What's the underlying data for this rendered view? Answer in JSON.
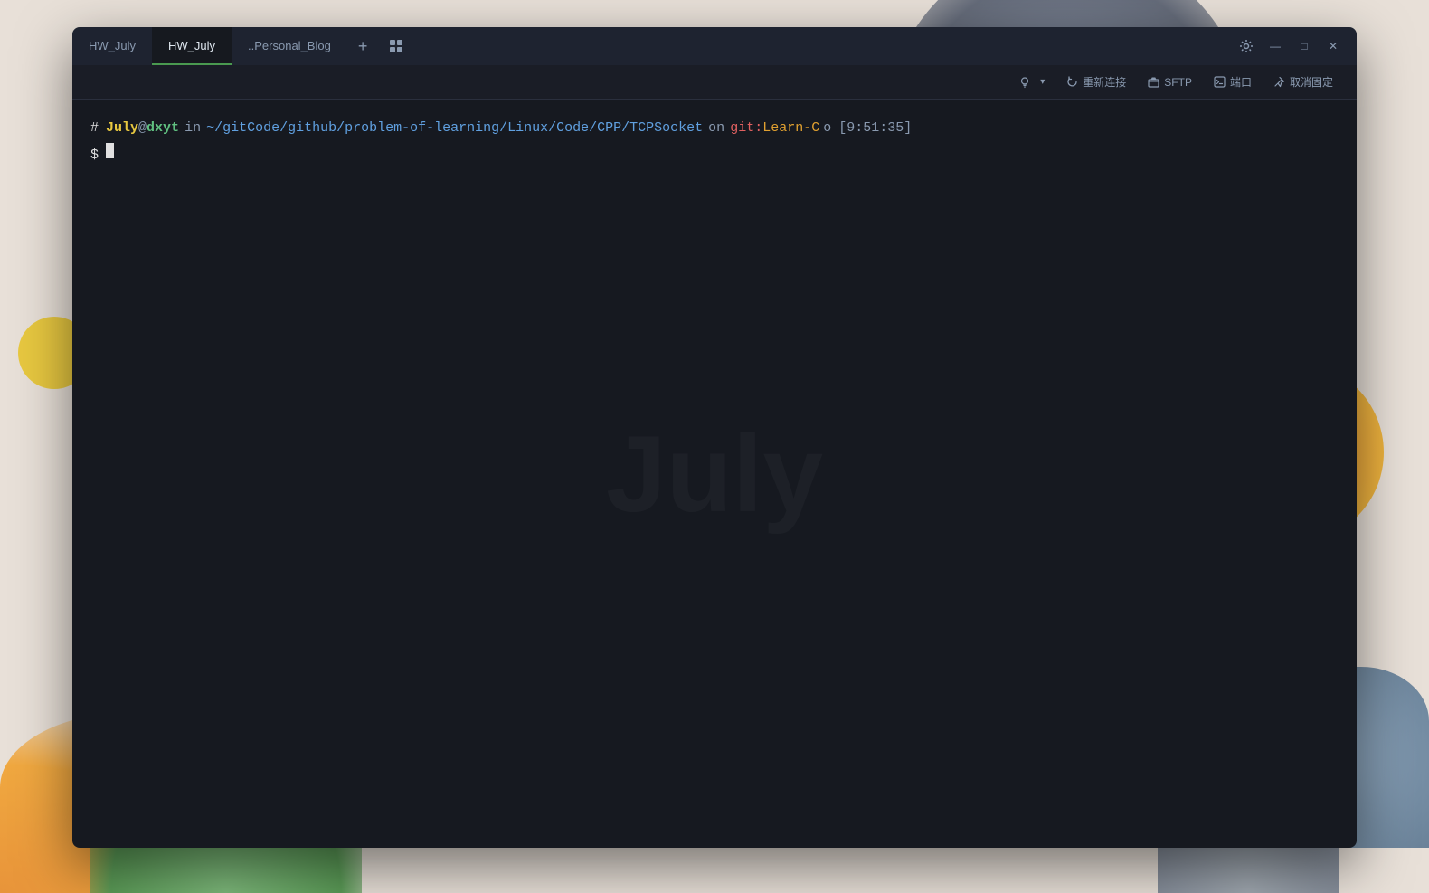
{
  "background": {
    "color": "#e0d8d0"
  },
  "tabs": [
    {
      "id": "tab1",
      "label": "HW_July",
      "active": false
    },
    {
      "id": "tab2",
      "label": "HW_July",
      "active": true
    },
    {
      "id": "tab3",
      "label": "..Personal_Blog",
      "active": false
    }
  ],
  "toolbar": {
    "reconnect_label": "重新连接",
    "sftp_label": "SFTP",
    "terminal_label": "端口",
    "unpin_label": "取消固定",
    "settings_icon": "⚙",
    "minimize_icon": "—",
    "maximize_icon": "□",
    "close_icon": "✕",
    "bulb_icon": "💡",
    "reconnect_icon": "↻",
    "sftp_icon": "📁",
    "terminal_icon": "▣",
    "unpin_icon": "📌",
    "dropdown_icon": "▾"
  },
  "terminal": {
    "prompt_hash": "#",
    "user": "July",
    "at": "@",
    "host": "dxyt",
    "in": "in",
    "path": "~/gitCode/github/problem-of-learning/Linux/Code/CPP/TCPSocket",
    "on": "on",
    "git_prefix": "git:",
    "branch": "Learn-C",
    "branch_suffix": "o",
    "time": "[9:51:35]",
    "dollar": "$",
    "watermark": "July"
  }
}
